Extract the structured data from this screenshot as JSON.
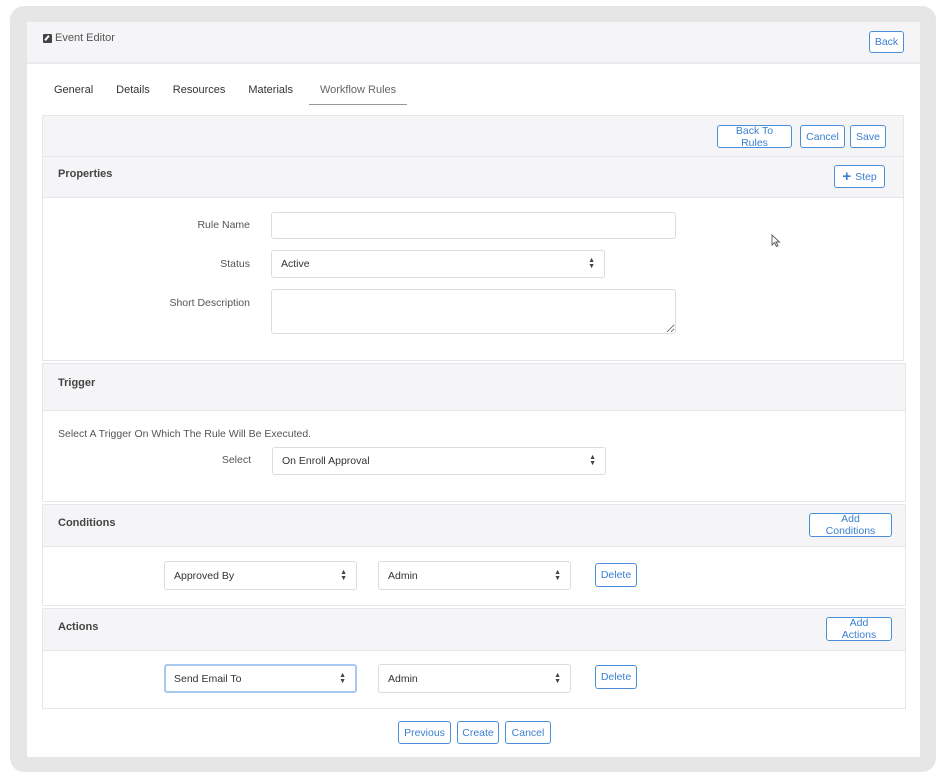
{
  "window": {
    "title": "Event Editor",
    "back_label": "Back"
  },
  "tabs": [
    {
      "label": "General",
      "active": false
    },
    {
      "label": "Details",
      "active": false
    },
    {
      "label": "Resources",
      "active": false
    },
    {
      "label": "Materials",
      "active": false
    },
    {
      "label": "Workflow Rules",
      "active": true
    }
  ],
  "toolbar": {
    "back_to_rules": "Back To Rules",
    "cancel": "Cancel",
    "save": "Save"
  },
  "properties": {
    "title": "Properties",
    "step_button": "Step",
    "rule_name": {
      "label": "Rule Name",
      "value": ""
    },
    "status": {
      "label": "Status",
      "value": "Active"
    },
    "short_description": {
      "label": "Short Description",
      "value": ""
    }
  },
  "trigger": {
    "title": "Trigger",
    "help_text": "Select A Trigger On Which The Rule Will Be Executed.",
    "select_label": "Select",
    "select_value": "On Enroll Approval"
  },
  "conditions": {
    "title": "Conditions",
    "add_button": "Add Conditions",
    "rows": [
      {
        "field": "Approved By",
        "value": "Admin",
        "delete": "Delete"
      }
    ]
  },
  "actions": {
    "title": "Actions",
    "add_button": "Add Actions",
    "rows": [
      {
        "field": "Send Email To",
        "value": "Admin",
        "delete": "Delete"
      }
    ]
  },
  "footer": {
    "previous": "Previous",
    "create": "Create",
    "cancel": "Cancel"
  },
  "colors": {
    "accent": "#3a7fd0",
    "header_bg": "#f5f5f7",
    "frame": "#e6e6e6"
  }
}
